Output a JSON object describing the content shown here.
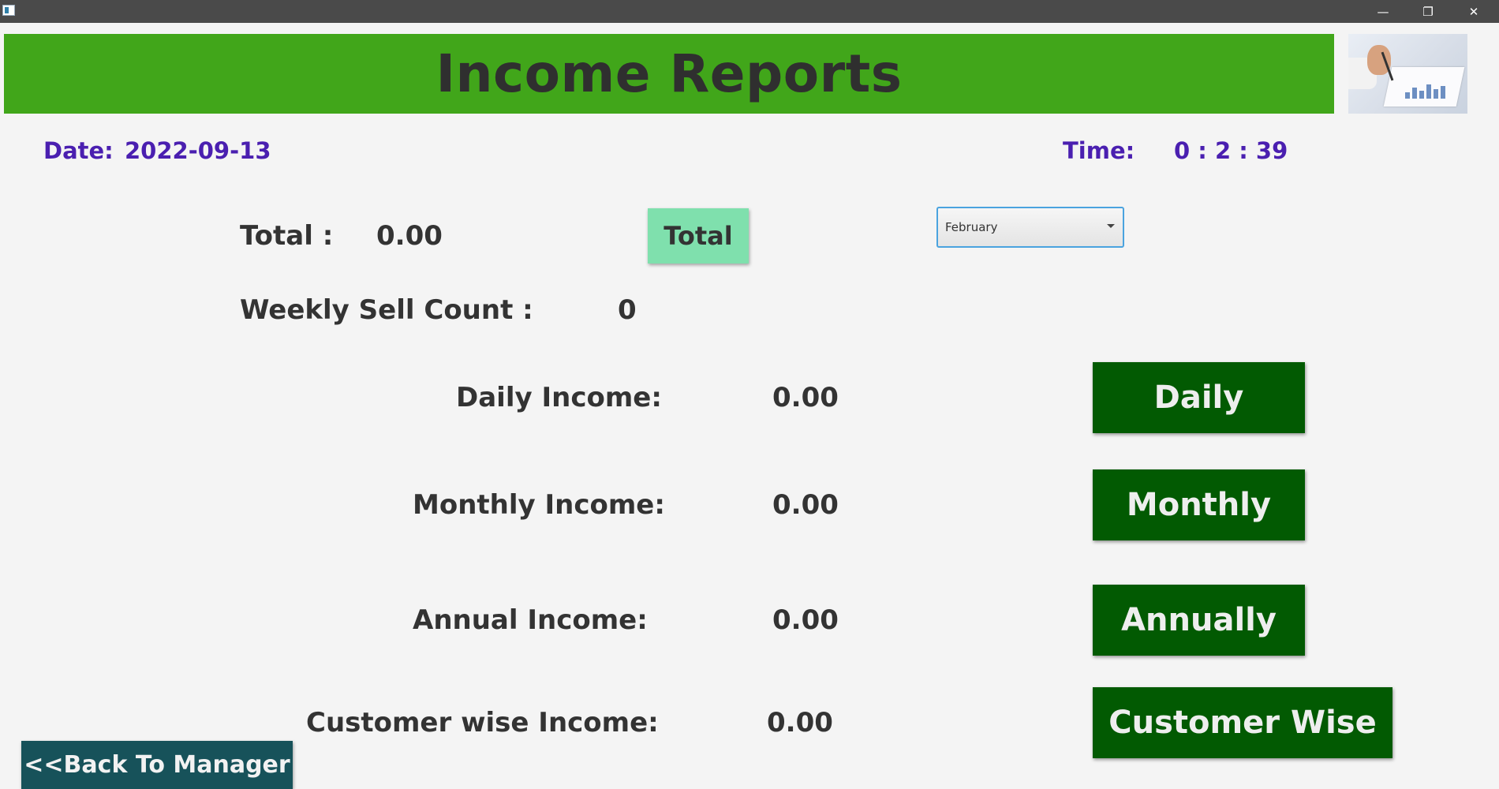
{
  "window": {
    "minimize_glyph": "—",
    "restore_glyph": "❐",
    "close_glyph": "✕"
  },
  "header": {
    "title": "Income Reports",
    "bar_color": "#41a61a"
  },
  "info": {
    "date_label": "Date:",
    "date_value": "2022-09-13",
    "time_label": "Time:",
    "time_value": "0 : 2 : 39"
  },
  "totals": {
    "total_label": "Total :",
    "total_value": "0.00",
    "total_button": "Total",
    "weekly_label": "Weekly Sell Count :",
    "weekly_value": "0"
  },
  "month_select": {
    "selected": "February"
  },
  "incomes": {
    "daily_label": "Daily Income:",
    "daily_value": "0.00",
    "daily_button": "Daily",
    "monthly_label": "Monthly Income:",
    "monthly_value": "0.00",
    "monthly_button": "Monthly",
    "annual_label": "Annual Income:",
    "annual_value": "0.00",
    "annual_button": "Annually",
    "customer_label": "Customer wise Income:",
    "customer_value": "0.00",
    "customer_button": "Customer Wise"
  },
  "nav": {
    "back_button": "<<Back To Manager"
  },
  "colors": {
    "accent_purple": "#4a1fb0",
    "button_dark_green": "#025a02",
    "button_mint": "#7fe0ad",
    "button_teal": "#17525a"
  }
}
